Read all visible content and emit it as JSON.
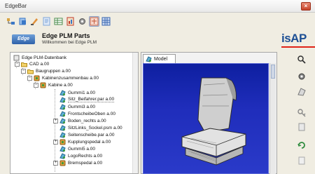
{
  "window": {
    "title": "EdgeBar",
    "close_glyph": "×"
  },
  "toolbar": {
    "buttons": [
      {
        "icon": "assembly-tree-icon",
        "color": "#d9a441"
      },
      {
        "icon": "open-icon",
        "color": "#3a78c7"
      },
      {
        "icon": "edit-icon",
        "color": "#e0903a"
      },
      {
        "icon": "document-icon",
        "color": "#7fa7d9"
      },
      {
        "icon": "table-icon",
        "color": "#4a8b4a"
      },
      {
        "icon": "report-icon",
        "color": "#c0392b"
      },
      {
        "icon": "gear-icon",
        "color": "#6b6b6b"
      },
      {
        "icon": "search-parts-icon",
        "color": "#c25a3a"
      },
      {
        "icon": "grid-icon",
        "color": "#3a66b0"
      }
    ]
  },
  "header": {
    "logo_text": "Edge",
    "title": "Edge PLM Parts",
    "subtitle": "Willkommen bei Edge PLM",
    "brand_isap": "isAP",
    "accent_color": "#e02318",
    "brand_color": "#1d4f94"
  },
  "tree": {
    "root_label": "Edge PLM-Datenbank",
    "items": [
      {
        "label": "CAD a.00",
        "icon": "folder-icon"
      },
      {
        "label": "Baugruppen a.00",
        "icon": "folder-icon"
      },
      {
        "label": "Kabinenzusammenbau a.00",
        "icon": "assembly-icon"
      },
      {
        "label": "Kabine a.00",
        "icon": "assembly-icon"
      },
      {
        "label": "Gummi1 a.00",
        "icon": "part-icon"
      },
      {
        "label": "Sitz_Beifahrer.par a.00",
        "icon": "part-icon"
      },
      {
        "label": "Gummi3 a.00",
        "icon": "part-icon"
      },
      {
        "label": "FrontscheibeOben a.00",
        "icon": "part-icon"
      },
      {
        "label": "Boden_rechts a.00",
        "icon": "part-icon"
      },
      {
        "label": "SitzLinks_Sockel.psm a.00",
        "icon": "part-icon"
      },
      {
        "label": "Seitenscheibe.par a.00",
        "icon": "part-icon"
      },
      {
        "label": "Kupplungspedal a.00",
        "icon": "assembly-icon"
      },
      {
        "label": "Gummi5 a.00",
        "icon": "part-icon"
      },
      {
        "label": "LogoRechts a.00",
        "icon": "part-icon"
      },
      {
        "label": "Bremspedal a.00",
        "icon": "assembly-icon"
      }
    ]
  },
  "viewer": {
    "tab_label": "Model",
    "background_color": "#1f2dbb"
  },
  "sidebar": {
    "icons": [
      "search-icon",
      "gear-icon",
      "part-icon",
      "key-icon",
      "document-icon",
      "refresh-icon",
      "document-icon"
    ]
  }
}
